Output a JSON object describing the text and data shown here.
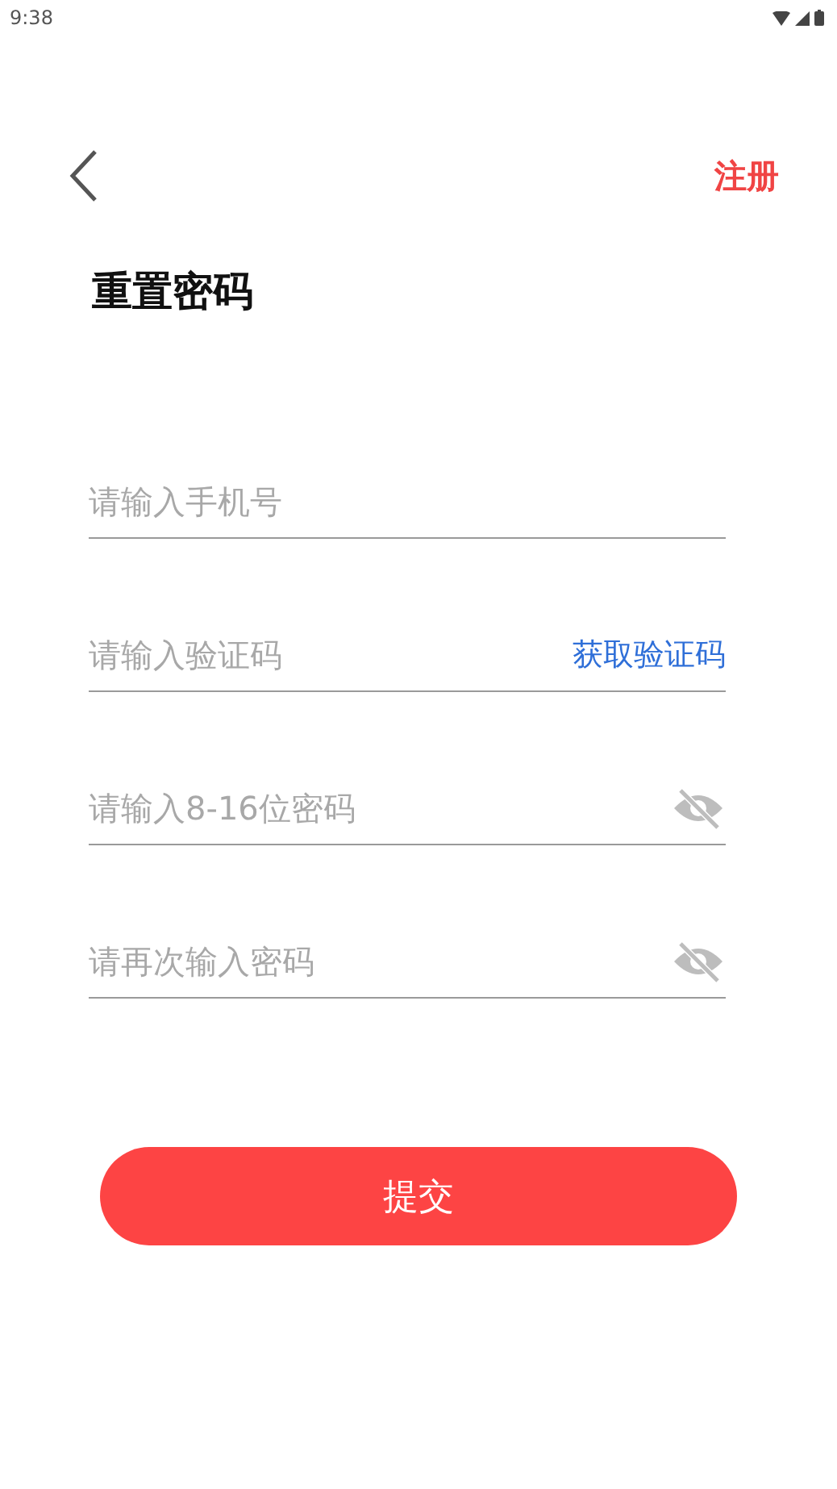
{
  "status_bar": {
    "time": "9:38"
  },
  "header": {
    "action": "注册"
  },
  "title": "重置密码",
  "fields": [
    {
      "kind": "plain",
      "placeholder": "请输入手机号"
    },
    {
      "kind": "code",
      "placeholder": "请输入验证码",
      "action": "获取验证码"
    },
    {
      "kind": "password",
      "placeholder": "请输入8-16位密码"
    },
    {
      "kind": "password",
      "placeholder": "请再次输入密码"
    }
  ],
  "submit": "提交"
}
